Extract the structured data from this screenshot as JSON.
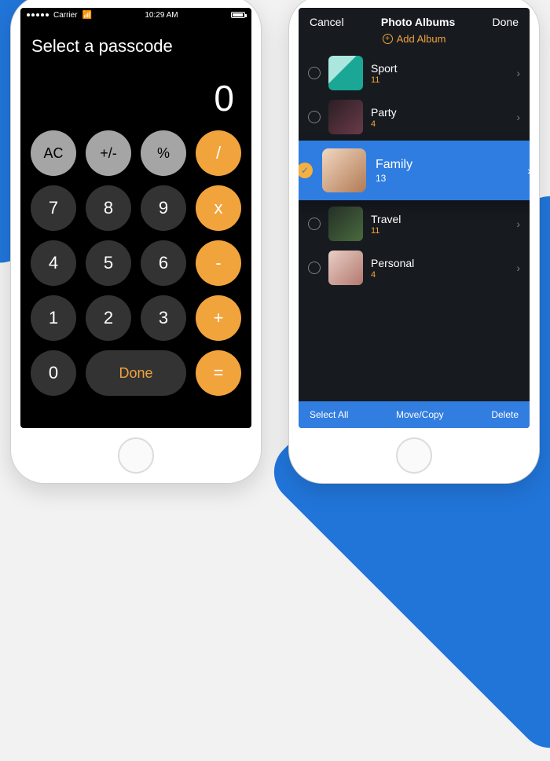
{
  "left": {
    "status": {
      "carrier": "Carrier",
      "time": "10:29 AM"
    },
    "title": "Select a passcode",
    "display": "0",
    "keys": {
      "ac": "AC",
      "pm": "+/-",
      "pct": "%",
      "div": "/",
      "k7": "7",
      "k8": "8",
      "k9": "9",
      "mul": "x",
      "k4": "4",
      "k5": "5",
      "k6": "6",
      "sub": "-",
      "k1": "1",
      "k2": "2",
      "k3": "3",
      "add": "+",
      "k0": "0",
      "done": "Done",
      "eq": "="
    }
  },
  "right": {
    "header": {
      "cancel": "Cancel",
      "title": "Photo Albums",
      "done": "Done"
    },
    "add_album": "Add Album",
    "albums": [
      {
        "name": "Sport",
        "count": "11",
        "thumb_class": "ph-sport",
        "selected": false
      },
      {
        "name": "Party",
        "count": "4",
        "thumb_class": "ph-party",
        "selected": false
      },
      {
        "name": "Family",
        "count": "13",
        "thumb_class": "ph-family",
        "selected": true
      },
      {
        "name": "Travel",
        "count": "11",
        "thumb_class": "ph-travel",
        "selected": false
      },
      {
        "name": "Personal",
        "count": "4",
        "thumb_class": "ph-personal",
        "selected": false
      }
    ],
    "bottom": {
      "select_all": "Select All",
      "move": "Move/Copy",
      "delete": "Delete"
    }
  }
}
